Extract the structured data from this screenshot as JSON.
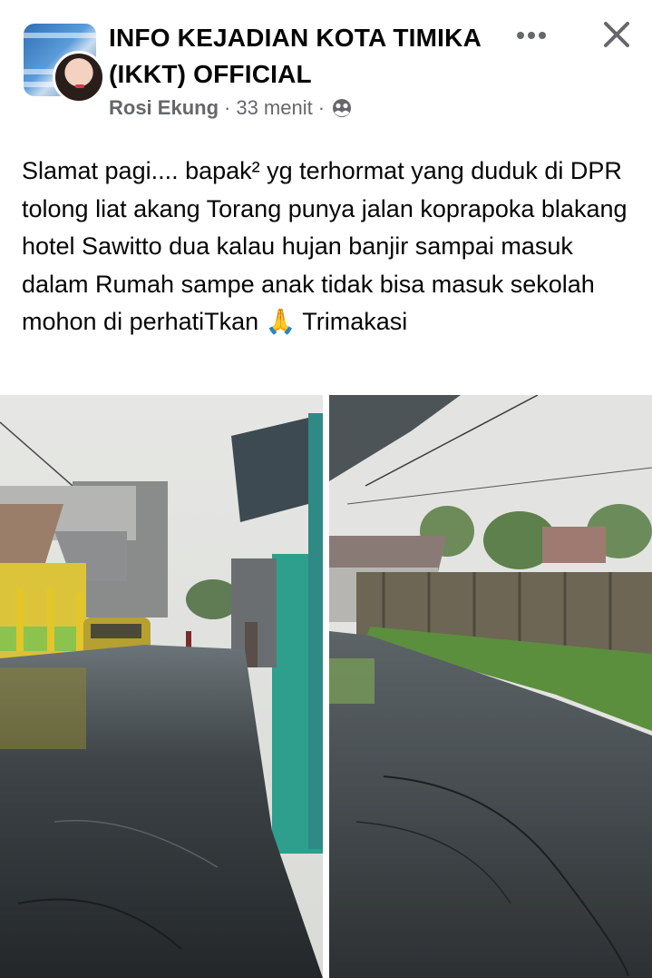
{
  "post": {
    "group_name": "INFO KEJADIAN KOTA TIMIKA (IKKT) OFFICIAL",
    "author": "Rosi Ekung",
    "time": "33 menit",
    "separator": "·",
    "privacy_icon": "globe-group-icon",
    "more_icon": "more-horizontal-icon",
    "close_icon": "close-icon",
    "text": "Slamat pagi.... bapak² yg terhormat yang duduk di DPR tolong liat akang Torang punya jalan koprapoka blakang hotel Sawitto dua kalau hujan banjir sampai masuk dalam Rumah sampe anak tidak bisa masuk sekolah mohon di perhatiTkan 🙏 Trimakasi"
  },
  "colors": {
    "text_primary": "#050505",
    "text_secondary": "#65676b",
    "background": "#ffffff",
    "flood_water": "#3a3f42"
  }
}
